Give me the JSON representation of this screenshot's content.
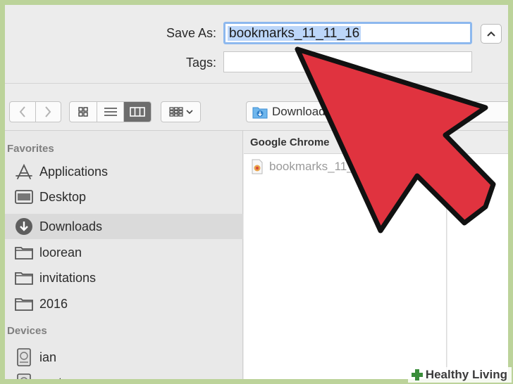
{
  "dialog": {
    "save_as_label": "Save As:",
    "save_as_value": "bookmarks_11_11_16",
    "tags_label": "Tags:",
    "tags_value": ""
  },
  "toolbar": {
    "location": "Downloads",
    "location_icon": "downloads-folder-icon",
    "view_modes": [
      "icon",
      "list",
      "column"
    ],
    "active_view": "column",
    "arrange_icon": "arrange-grid-icon"
  },
  "sidebar": {
    "favorites_heading": "Favorites",
    "favorites": [
      {
        "label": "Applications",
        "icon": "applications-icon"
      },
      {
        "label": "Desktop",
        "icon": "desktop-icon"
      },
      {
        "label": "Downloads",
        "icon": "downloads-icon",
        "selected": true
      },
      {
        "label": "loorean",
        "icon": "folder-icon"
      },
      {
        "label": "invitations",
        "icon": "folder-icon"
      },
      {
        "label": "2016",
        "icon": "folder-icon"
      }
    ],
    "devices_heading": "Devices",
    "devices": [
      {
        "label": "ian",
        "icon": "disk-icon"
      },
      {
        "label": "system",
        "icon": "disk-icon"
      }
    ]
  },
  "browser": {
    "column_title": "Google Chrome",
    "files": [
      {
        "name": "bookmarks_11_11_16",
        "icon": "html-file-icon"
      }
    ]
  },
  "watermark": {
    "text": "Healthy Living",
    "color": "#3a8d3a"
  },
  "colors": {
    "arrow_fill": "#e0333f",
    "arrow_stroke": "#111111",
    "background": "#bcd39a",
    "selection": "#bcd6f9"
  }
}
